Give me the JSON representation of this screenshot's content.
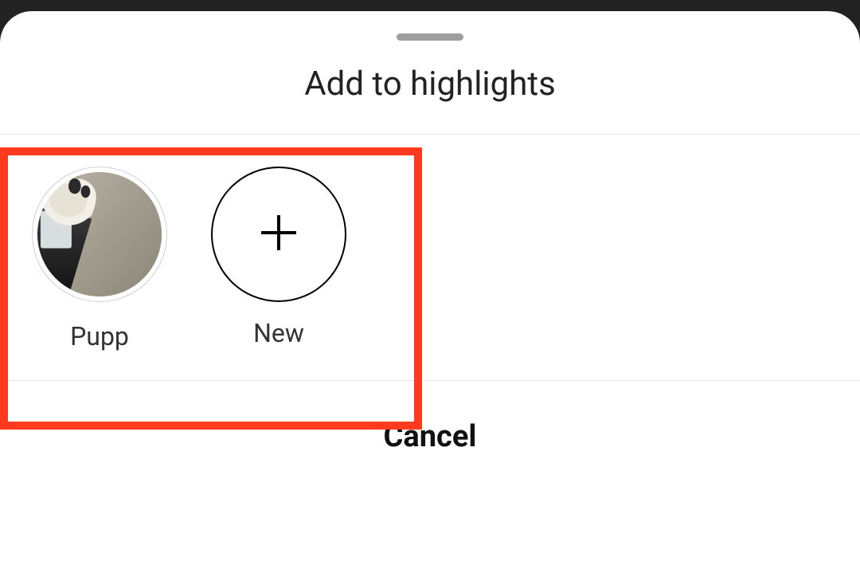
{
  "sheet": {
    "title": "Add to highlights",
    "cancel_label": "Cancel"
  },
  "highlights": {
    "existing": [
      {
        "label": "Pupp"
      }
    ],
    "new_label": "New"
  },
  "annotation": {
    "color": "#ff3a1f"
  }
}
